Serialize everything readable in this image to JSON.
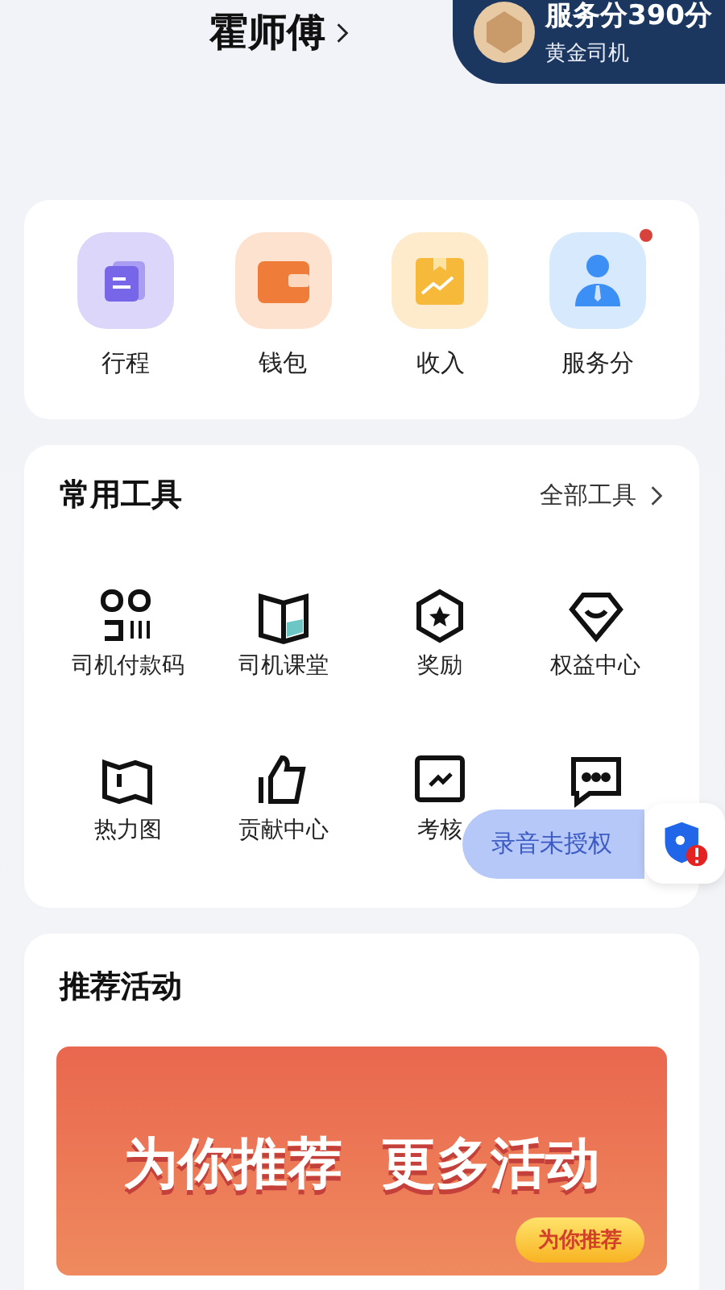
{
  "header": {
    "name": "霍师傅",
    "score": "服务分390分",
    "level": "黄金司机"
  },
  "quick": [
    {
      "label": "行程",
      "badge": false
    },
    {
      "label": "钱包",
      "badge": false
    },
    {
      "label": "收入",
      "badge": false
    },
    {
      "label": "服务分",
      "badge": true
    }
  ],
  "tools": {
    "title": "常用工具",
    "all_link": "全部工具",
    "items": [
      {
        "kind": "labeled",
        "label": "司机付款码"
      },
      {
        "kind": "labeled",
        "label": "司机课堂"
      },
      {
        "kind": "labeled",
        "label": "奖励"
      },
      {
        "kind": "labeled",
        "label": "权益中心"
      },
      {
        "kind": "labeled",
        "label": "热力图"
      },
      {
        "kind": "labeled",
        "label": "贡献中心"
      },
      {
        "kind": "labeled",
        "label": "考核"
      },
      {
        "kind": "covered"
      }
    ]
  },
  "floating": {
    "text": "录音未授权"
  },
  "promo": {
    "title": "推荐活动",
    "headline": "为你推荐  更多活动",
    "button": "为你推荐"
  }
}
